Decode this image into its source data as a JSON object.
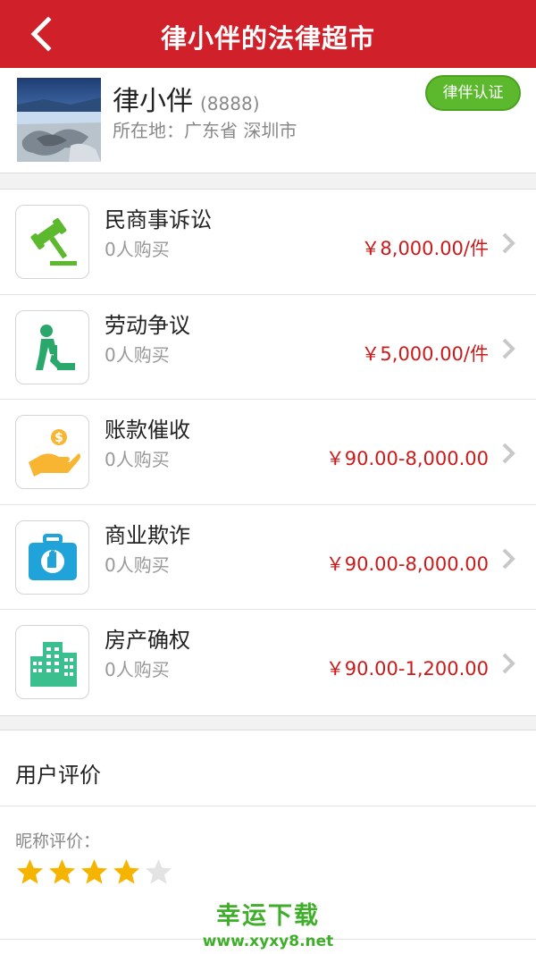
{
  "header": {
    "title": "律小伴的法律超市",
    "back_icon": "back-arrow-icon"
  },
  "profile": {
    "name": "律小伴",
    "id": "(8888)",
    "location": "所在地：广东省 深圳市",
    "badge": "律伴认证"
  },
  "services": [
    {
      "name": "民商事诉讼",
      "buyers": "0人购买",
      "price": "￥8,000.00/件",
      "icon": "gavel-icon",
      "icon_color": "#5cb82c"
    },
    {
      "name": "劳动争议",
      "buyers": "0人购买",
      "price": "￥5,000.00/件",
      "icon": "worker-icon",
      "icon_color": "#2aa86b"
    },
    {
      "name": "账款催收",
      "buyers": "0人购买",
      "price": "￥90.00-8,000.00",
      "icon": "money-hand-icon",
      "icon_color": "#f7b531"
    },
    {
      "name": "商业欺诈",
      "buyers": "0人购买",
      "price": "￥90.00-8,000.00",
      "icon": "briefcase-hand-icon",
      "icon_color": "#1fa3d9"
    },
    {
      "name": "房产确权",
      "buyers": "0人购买",
      "price": "￥90.00-1,200.00",
      "icon": "buildings-icon",
      "icon_color": "#3cbf8f"
    }
  ],
  "reviews": {
    "title": "用户评价",
    "nickname_label": "昵称评价：",
    "rating": 4,
    "max_rating": 5
  },
  "watermark": {
    "line1": "幸运下载",
    "line2": "www.xyxy8.net"
  },
  "colors": {
    "brand_red": "#d0202a",
    "price_red": "#cc1a1a",
    "badge_green": "#5cb82c",
    "star_gold": "#f5b400"
  }
}
